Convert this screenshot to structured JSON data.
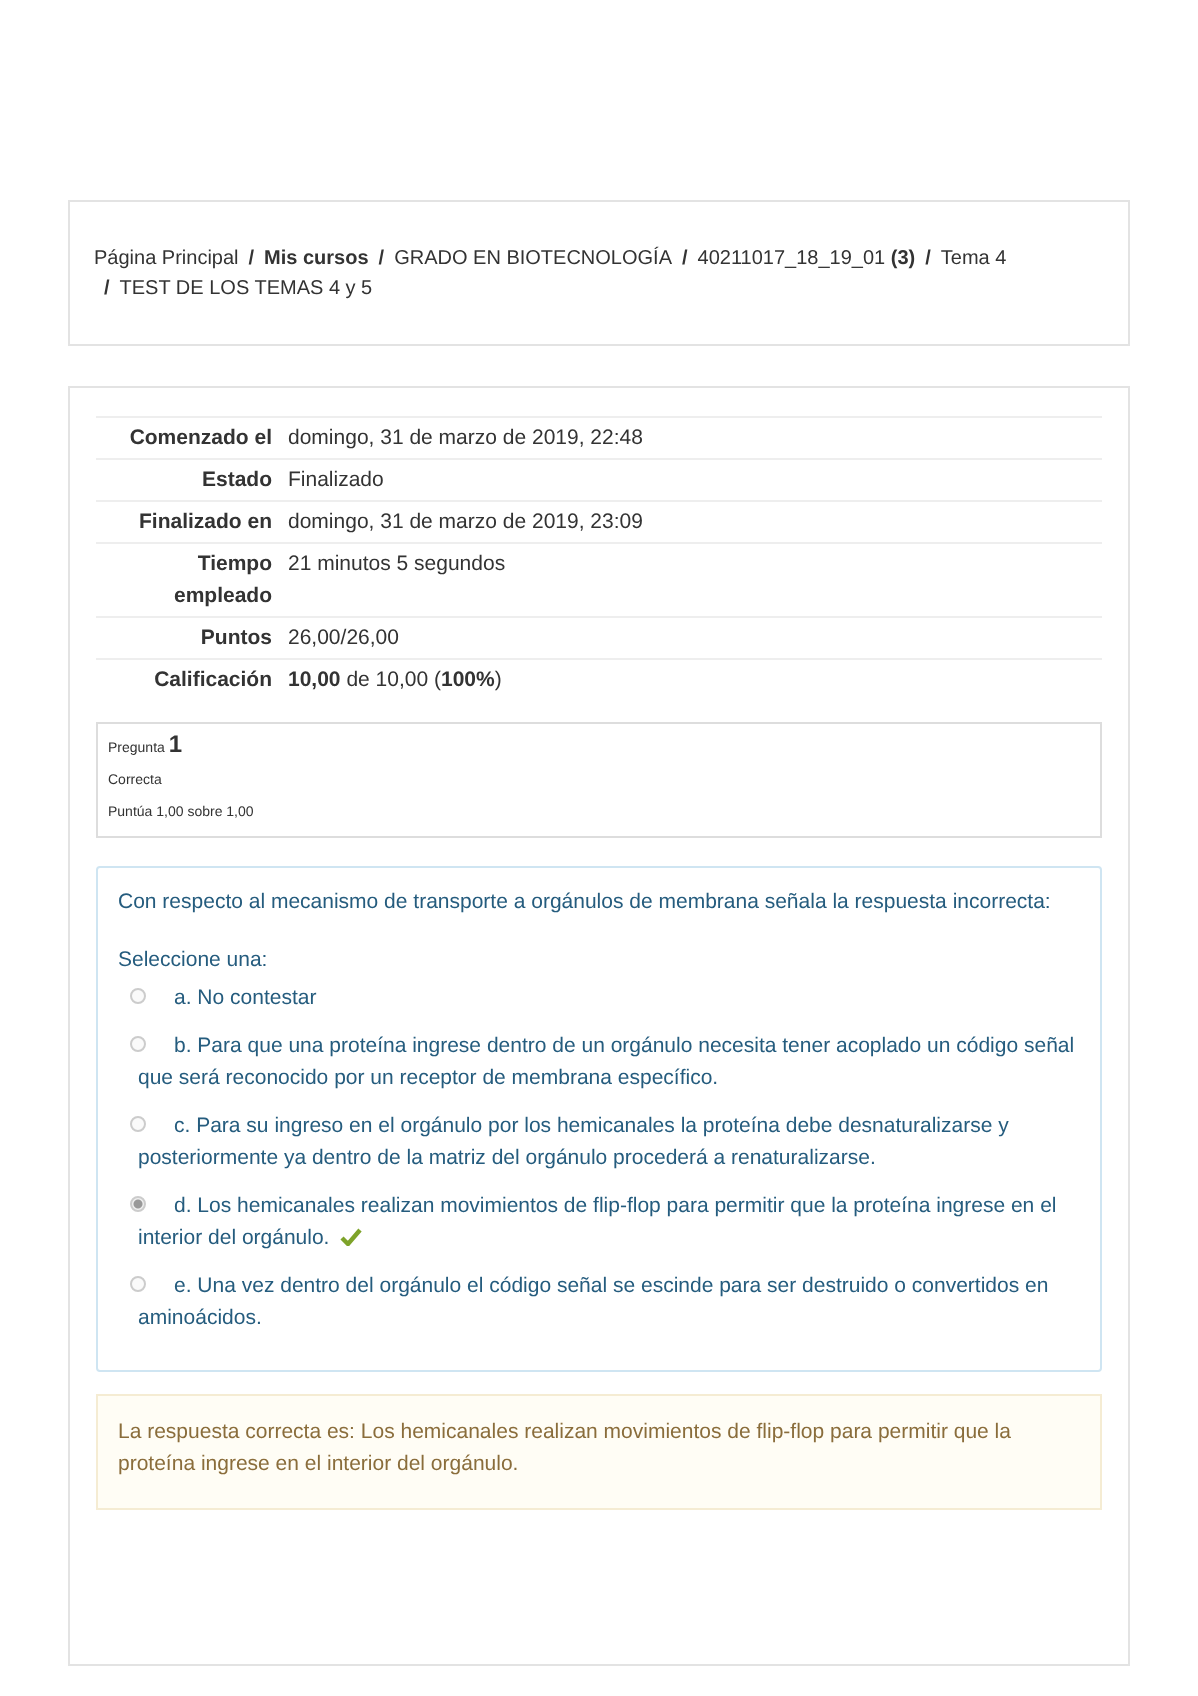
{
  "breadcrumb_separator": "/",
  "breadcrumb": [
    {
      "text": "Página Principal",
      "bold": false
    },
    {
      "text": "Mis cursos",
      "bold": true
    },
    {
      "text": "GRADO EN BIOTECNOLOGÍA",
      "bold": false
    },
    {
      "text": "40211017_18_19_01 **(3)**",
      "bold": false
    },
    {
      "text": "Tema 4",
      "bold": false
    },
    {
      "text": "TEST DE LOS TEMAS 4 y 5",
      "bold": false
    }
  ],
  "summary": [
    {
      "label": "Comenzado el",
      "value": "domingo, 31 de marzo de 2019, 22:48"
    },
    {
      "label": "Estado",
      "value": "Finalizado"
    },
    {
      "label": "Finalizado en",
      "value": "domingo, 31 de marzo de 2019, 23:09"
    },
    {
      "label": "Tiempo empleado",
      "value": "21 minutos 5 segundos"
    },
    {
      "label": "Puntos",
      "value": "26,00/26,00"
    },
    {
      "label": "Calificación",
      "value": "**10,00** de 10,00 (**100%**)"
    }
  ],
  "question_info": {
    "label": "Pregunta",
    "number": "1",
    "state": "Correcta",
    "grade": "Puntúa 1,00 sobre 1,00"
  },
  "question": {
    "text": "Con respecto al mecanismo de transporte a orgánulos de membrana señala la respuesta incorrecta:",
    "prompt": "Seleccione una:",
    "options": [
      {
        "text": "a. No contestar",
        "selected": false,
        "correct": false
      },
      {
        "text": "b. Para que una proteína ingrese dentro de un orgánulo necesita tener acoplado un código señal que será reconocido por un receptor de membrana específico.",
        "selected": false,
        "correct": false
      },
      {
        "text": "c. Para su ingreso en el orgánulo por los hemicanales la proteína debe desnaturalizarse y posteriormente ya dentro de la matriz del orgánulo procederá a renaturalizarse.",
        "selected": false,
        "correct": false
      },
      {
        "text": "d. Los hemicanales realizan movimientos de flip-flop para permitir que la proteína ingrese en el interior del orgánulo.",
        "selected": true,
        "correct": true
      },
      {
        "text": "e. Una vez dentro del orgánulo el código señal se escinde para ser destruido o convertidos en aminoácidos.",
        "selected": false,
        "correct": false
      }
    ]
  },
  "feedback": "La respuesta correcta es: Los hemicanales realizan movimientos de flip-flop para permitir que la proteína ingrese en el interior del orgánulo."
}
